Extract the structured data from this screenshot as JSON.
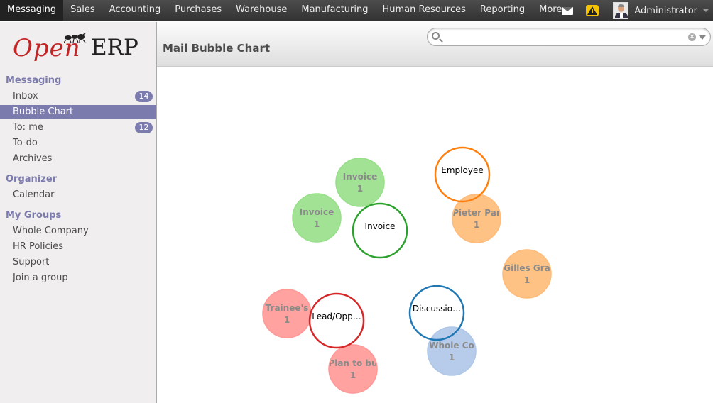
{
  "topbar": {
    "menu": [
      "Messaging",
      "Sales",
      "Accounting",
      "Purchases",
      "Warehouse",
      "Manufacturing",
      "Human Resources",
      "Reporting",
      "More"
    ],
    "active_index": 0,
    "user_name": "Administrator"
  },
  "sidebar": {
    "logo_open": "Open",
    "logo_erp": "ERP",
    "sections": [
      {
        "title": "Messaging",
        "items": [
          {
            "label": "Inbox",
            "badge": "14"
          },
          {
            "label": "Bubble Chart",
            "badge": "",
            "active": true
          },
          {
            "label": "To: me",
            "badge": "12"
          },
          {
            "label": "To-do",
            "badge": ""
          },
          {
            "label": "Archives",
            "badge": ""
          }
        ]
      },
      {
        "title": "Organizer",
        "items": [
          {
            "label": "Calendar",
            "badge": ""
          }
        ]
      },
      {
        "title": "My Groups",
        "items": [
          {
            "label": "Whole Company",
            "badge": ""
          },
          {
            "label": "HR Policies",
            "badge": ""
          },
          {
            "label": "Support",
            "badge": ""
          },
          {
            "label": "Join a group",
            "badge": ""
          }
        ]
      }
    ]
  },
  "header": {
    "title": "Mail Bubble Chart",
    "search_value": "",
    "search_placeholder": ""
  },
  "colors": {
    "green": "#2ca02c",
    "orange": "#ff7f0e",
    "red": "#d62728",
    "blue": "#1f77b4",
    "green_fill": "#98df8a",
    "orange_fill": "#ffbb78",
    "red_fill": "#ff9896",
    "blue_fill": "#aec7e8"
  },
  "bubbles": {
    "groups": [
      {
        "name": "Invoice",
        "color": "green",
        "children": [
          {
            "label": "Invoice",
            "count": "1"
          },
          {
            "label": "Invoice",
            "count": "1"
          }
        ]
      },
      {
        "name": "Employee",
        "color": "orange",
        "children": [
          {
            "label": "Pieter Par",
            "count": "1"
          },
          {
            "label": "Gilles Gra",
            "count": "1"
          }
        ]
      },
      {
        "name": "Lead/Opp…",
        "color": "red",
        "children": [
          {
            "label": "Trainee's",
            "count": "1"
          },
          {
            "label": "Plan to bu",
            "count": "1"
          }
        ]
      },
      {
        "name": "Discussio…",
        "color": "blue",
        "children": [
          {
            "label": "Whole Co",
            "count": "1"
          }
        ]
      }
    ]
  }
}
